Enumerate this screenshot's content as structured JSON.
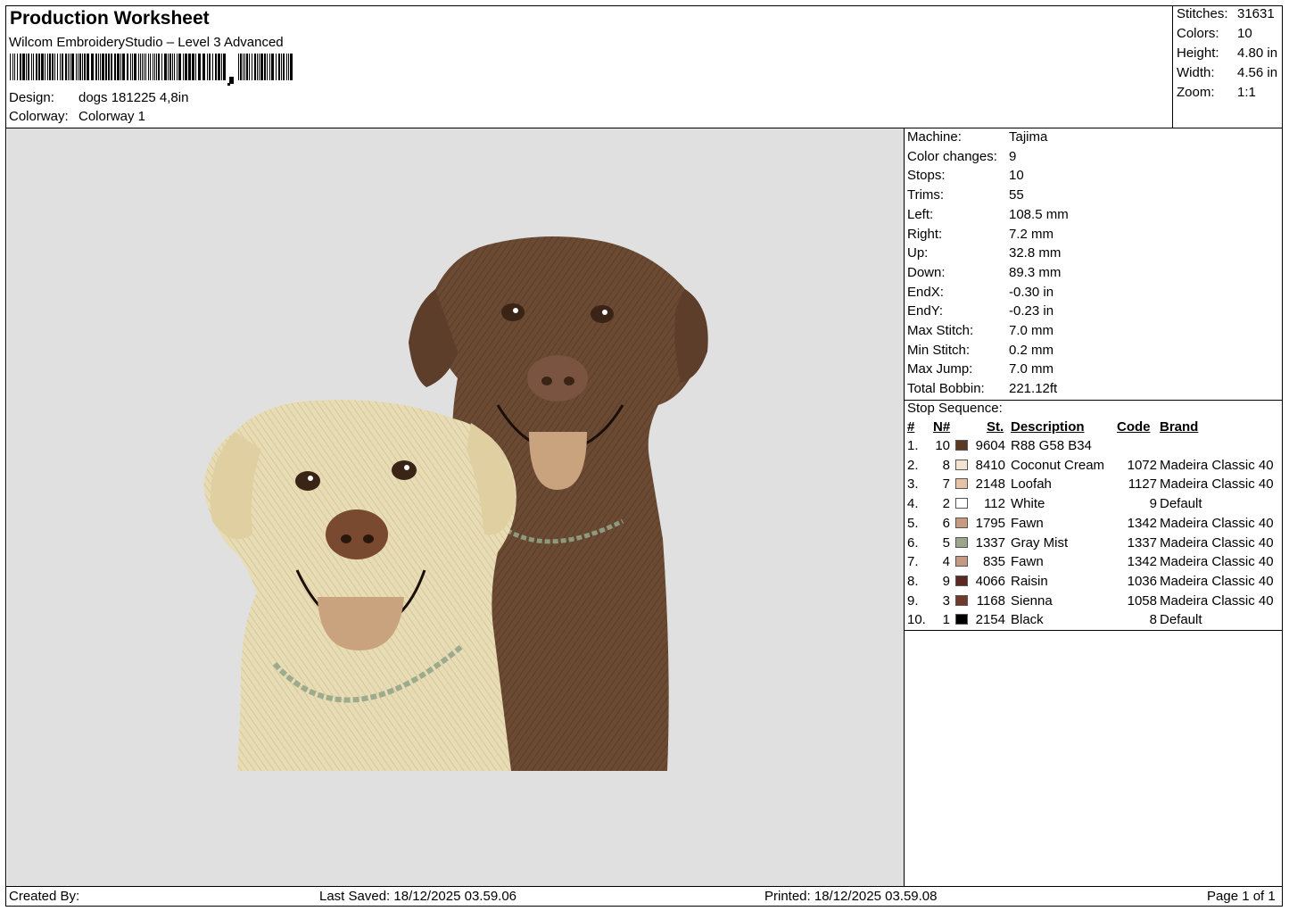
{
  "header": {
    "title": "Production Worksheet",
    "software": "Wilcom EmbroideryStudio – Level 3 Advanced",
    "design_label": "Design:",
    "design_value": "dogs 181225 4,8in",
    "colorway_label": "Colorway:",
    "colorway_value": "Colorway 1"
  },
  "summary": [
    {
      "label": "Stitches:",
      "value": "31631"
    },
    {
      "label": "Colors:",
      "value": "10"
    },
    {
      "label": "Height:",
      "value": "4.80 in"
    },
    {
      "label": "Width:",
      "value": "4.56 in"
    },
    {
      "label": "Zoom:",
      "value": "1:1"
    }
  ],
  "machine_info": [
    {
      "label": "Machine:",
      "value": "Tajima"
    },
    {
      "label": "Color changes:",
      "value": "9"
    },
    {
      "label": "Stops:",
      "value": "10"
    },
    {
      "label": "Trims:",
      "value": "55"
    },
    {
      "label": "Left:",
      "value": "108.5 mm"
    },
    {
      "label": "Right:",
      "value": "7.2 mm"
    },
    {
      "label": "Up:",
      "value": "32.8 mm"
    },
    {
      "label": "Down:",
      "value": "89.3 mm"
    },
    {
      "label": "EndX:",
      "value": "-0.30 in"
    },
    {
      "label": "EndY:",
      "value": "-0.23 in"
    },
    {
      "label": "Max Stitch:",
      "value": "7.0 mm"
    },
    {
      "label": "Min Stitch:",
      "value": "0.2 mm"
    },
    {
      "label": "Max Jump:",
      "value": "7.0 mm"
    },
    {
      "label": "Total Bobbin:",
      "value": "221.12ft"
    }
  ],
  "stop_sequence": {
    "title": "Stop Sequence:",
    "headers": {
      "idx": "#",
      "n": "N#",
      "st": "St.",
      "desc": "Description",
      "code": "Code",
      "brand": "Brand"
    },
    "rows": [
      {
        "idx": "1.",
        "n": "10",
        "color": "#5a3a22",
        "st": "9604",
        "desc": "R88 G58 B34",
        "code": "",
        "brand": ""
      },
      {
        "idx": "2.",
        "n": "8",
        "color": "#f3e3d0",
        "st": "8410",
        "desc": "Coconut Cream",
        "code": "1072",
        "brand": "Madeira Classic 40"
      },
      {
        "idx": "3.",
        "n": "7",
        "color": "#e6c3a6",
        "st": "2148",
        "desc": "Loofah",
        "code": "1127",
        "brand": "Madeira Classic 40"
      },
      {
        "idx": "4.",
        "n": "2",
        "color": "#ffffff",
        "st": "112",
        "desc": "White",
        "code": "9",
        "brand": "Default"
      },
      {
        "idx": "5.",
        "n": "6",
        "color": "#c89a80",
        "st": "1795",
        "desc": "Fawn",
        "code": "1342",
        "brand": "Madeira Classic 40"
      },
      {
        "idx": "6.",
        "n": "5",
        "color": "#9da58e",
        "st": "1337",
        "desc": "Gray Mist",
        "code": "1337",
        "brand": "Madeira Classic 40"
      },
      {
        "idx": "7.",
        "n": "4",
        "color": "#c49a84",
        "st": "835",
        "desc": "Fawn",
        "code": "1342",
        "brand": "Madeira Classic 40"
      },
      {
        "idx": "8.",
        "n": "9",
        "color": "#5a2a22",
        "st": "4066",
        "desc": "Raisin",
        "code": "1036",
        "brand": "Madeira Classic 40"
      },
      {
        "idx": "9.",
        "n": "3",
        "color": "#6e3a2c",
        "st": "1168",
        "desc": "Sienna",
        "code": "1058",
        "brand": "Madeira Classic 40"
      },
      {
        "idx": "10.",
        "n": "1",
        "color": "#000000",
        "st": "2154",
        "desc": "Black",
        "code": "8",
        "brand": "Default"
      }
    ]
  },
  "footer": {
    "created_by": "Created By:",
    "last_saved": "Last Saved: 18/12/2025 03.59.06",
    "printed": "Printed: 18/12/2025 03.59.08",
    "page": "Page 1 of 1"
  },
  "colors": {
    "preview_bg": "#e0e0e0",
    "light_dog": "#e8dcb4",
    "dark_dog": "#6b4a34"
  }
}
